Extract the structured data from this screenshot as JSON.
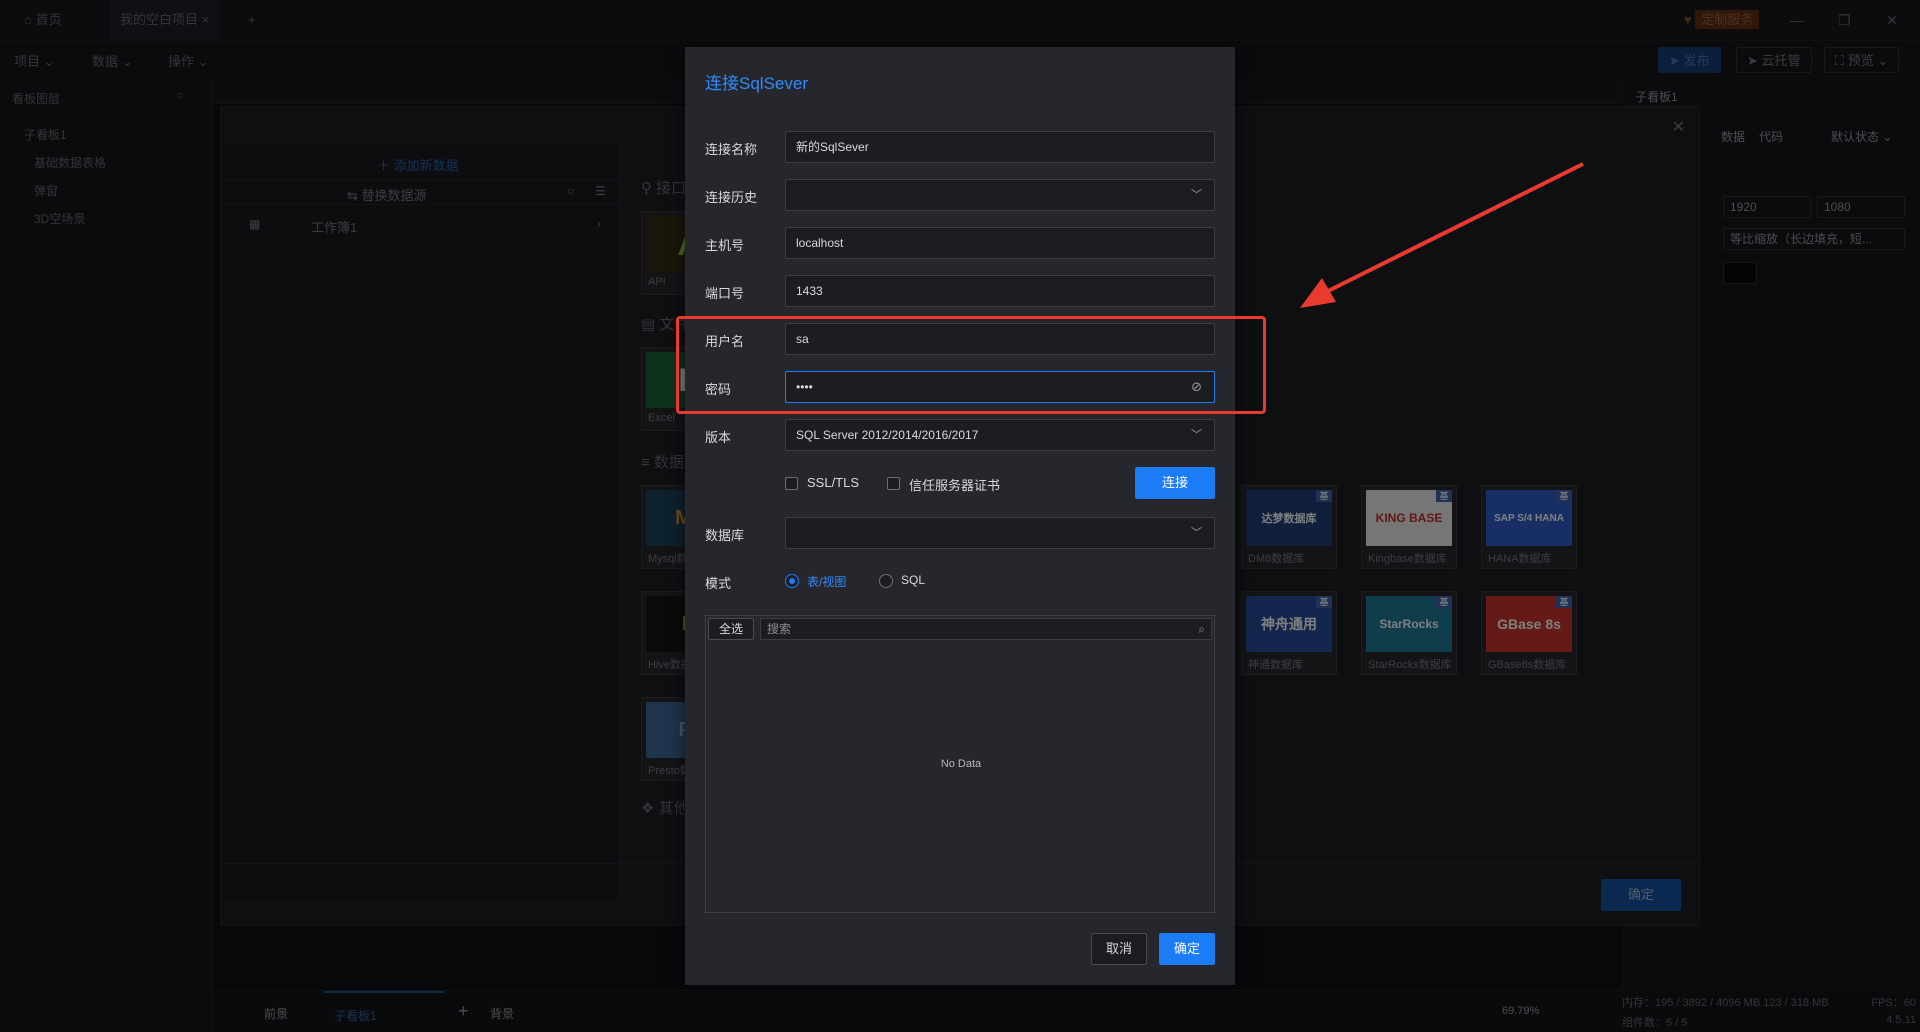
{
  "titlebar": {
    "home_tab": "首页",
    "project_tab": "我的空白项目",
    "service_label": "定制服务"
  },
  "menubar": {
    "project": "项目",
    "data": "数据",
    "operation": "操作",
    "publish": "发布",
    "cloud": "云托管",
    "preview": "预览"
  },
  "left_panel": {
    "title": "看板图层",
    "items": [
      "子看板1",
      "基础数据表格",
      "弹窗",
      "3D空场景"
    ]
  },
  "right_panel": {
    "tab_title": "子看板1",
    "tabs": [
      "数据",
      "代码"
    ],
    "state": "默认状态",
    "width": "1920",
    "height": "1080",
    "unit": "px",
    "scale_mode": "等比缩放（长边填充，短..."
  },
  "bottom": {
    "front": "前景",
    "sub_board": "子看板1",
    "background": "背景",
    "zoom": "69.79%"
  },
  "status": {
    "memory": "内存：195 / 3892 / 4096 MB  123 / 318 MB",
    "fps": "FPS：60",
    "components": "组件数：5 / 5",
    "version": "4.5.11"
  },
  "ds_dialog": {
    "add_new": "添加新数据",
    "replace": "替换数据源",
    "sheet": "工作簿1",
    "confirm": "确定",
    "sections": [
      "接口",
      "文件",
      "数据库",
      "其他"
    ],
    "cards_left": [
      {
        "logo": "A",
        "caption": "API"
      },
      {
        "logo": "E",
        "caption": "Excel"
      },
      {
        "logo": "My",
        "caption": "Mysql数据库"
      },
      {
        "logo": "H",
        "caption": "Hive数据库"
      },
      {
        "logo": "Pr",
        "caption": "Presto数据库"
      }
    ],
    "cards_right": [
      {
        "logo": "达梦数据库",
        "caption": "DM8数据库",
        "badge": "基",
        "color": "#1e3a6e"
      },
      {
        "logo": "KING BASE",
        "caption": "Kingbase数据库",
        "badge": "基",
        "color": "#e8e8e8"
      },
      {
        "logo": "SAP S/4 HANA",
        "caption": "HANA数据库",
        "badge": "基",
        "color": "#2a56b8"
      },
      {
        "logo": "神舟通用",
        "caption": "神通数据库",
        "badge": "基",
        "color": "#23468c"
      },
      {
        "logo": "StarRocks",
        "caption": "StarRocks数据库",
        "badge": "基",
        "color": "#1c6f8a"
      },
      {
        "logo": "GBase 8s",
        "caption": "GBase8s数据库",
        "badge": "基",
        "color": "#b8302a"
      }
    ]
  },
  "modal": {
    "title": "连接SqlSever",
    "fields": {
      "name_label": "连接名称",
      "name_value": "新的SqlSever",
      "history_label": "连接历史",
      "host_label": "主机号",
      "host_value": "localhost",
      "port_label": "端口号",
      "port_value": "1433",
      "user_label": "用户名",
      "user_value": "sa",
      "password_label": "密码",
      "password_value": "••••",
      "version_label": "版本",
      "version_value": "SQL Server 2012/2014/2016/2017",
      "ssl_label": "SSL/TLS",
      "trust_label": "信任服务器证书",
      "connect_button": "连接",
      "database_label": "数据库",
      "mode_label": "模式",
      "mode_table": "表/视图",
      "mode_sql": "SQL"
    },
    "table": {
      "select_all": "全选",
      "search_placeholder": "搜索",
      "empty": "No Data"
    },
    "cancel": "取消",
    "ok": "确定"
  },
  "colors": {
    "accent": "#1b7cf6",
    "highlight": "#e83a2f"
  }
}
